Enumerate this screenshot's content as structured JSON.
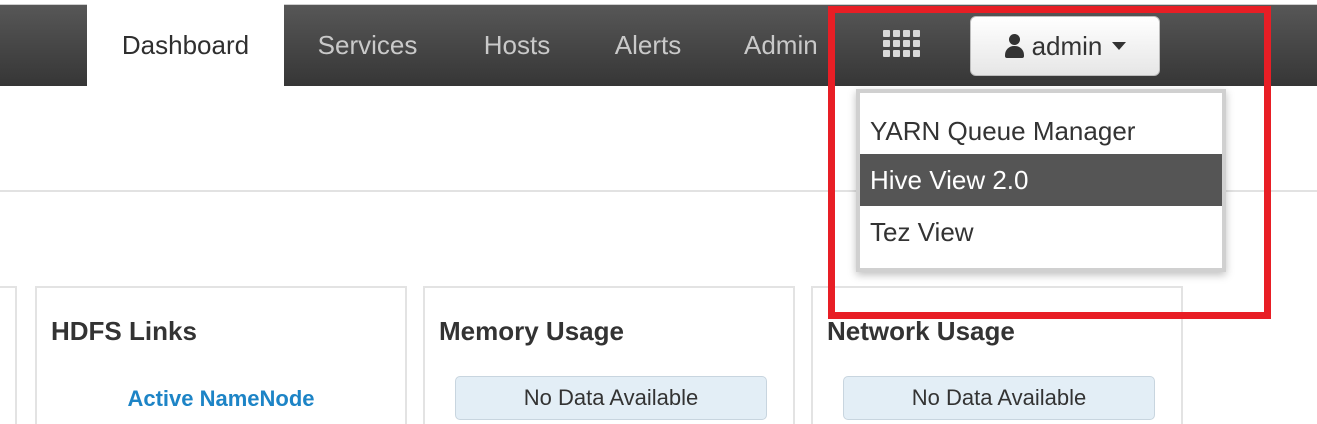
{
  "nav": {
    "tabs": [
      {
        "label": "Dashboard",
        "active": true
      },
      {
        "label": "Services"
      },
      {
        "label": "Hosts"
      },
      {
        "label": "Alerts"
      },
      {
        "label": "Admin"
      }
    ],
    "views_icon": "grid-icon",
    "user": {
      "label": "admin",
      "icon": "user-icon"
    }
  },
  "views_menu": {
    "items": [
      {
        "label": "YARN Queue Manager"
      },
      {
        "label": "Hive View 2.0",
        "highlighted": true
      },
      {
        "label": "Tez View"
      }
    ]
  },
  "widgets": {
    "hdfs_links": {
      "title": "HDFS Links",
      "link": "Active NameNode"
    },
    "memory_usage": {
      "title": "Memory Usage",
      "status": "No Data Available"
    },
    "network_usage": {
      "title": "Network Usage",
      "status": "No Data Available"
    }
  },
  "colors": {
    "highlight_border": "#e81e25",
    "link": "#1d84c6",
    "nav_bg": "#454545",
    "menu_hover": "#555555",
    "nodata_bg": "#e3eef6"
  }
}
